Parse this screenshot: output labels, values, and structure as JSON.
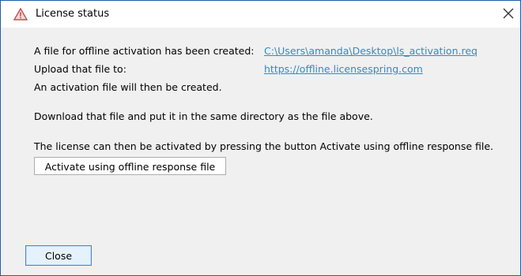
{
  "window": {
    "title": "License status",
    "icons": {
      "app": "warning-triangle-icon",
      "close": "close-icon"
    }
  },
  "info": {
    "file_created_label": "A file for offline activation has been created:",
    "file_path": "C:\\Users\\amanda\\Desktop\\ls_activation.req",
    "upload_label": "Upload that file to:",
    "upload_url": "https://offline.licensespring.com",
    "activation_created_text": "An activation file will then be created.",
    "download_instruction": "Download that file and put it in the same directory as the file above.",
    "activate_instruction": "The license can then be activated by pressing the button Activate using offline response file."
  },
  "buttons": {
    "activate_label": "Activate using offline response file",
    "close_label": "Close"
  },
  "colors": {
    "link": "#2f8cc9",
    "icon": "#c0504d",
    "focus_border": "#3c8ad8"
  }
}
